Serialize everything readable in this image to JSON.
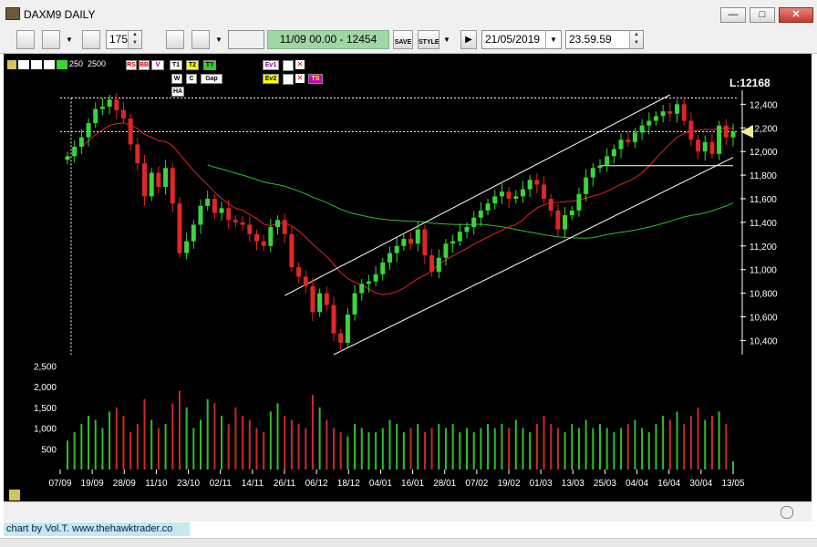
{
  "window": {
    "title": "DAXM9 DAILY",
    "minimize": "—",
    "maximize": "□",
    "close": "✕"
  },
  "toolbar": {
    "bars_value": "175",
    "info_text": "11/09 00.00 - 12454",
    "save_label": "SAVE",
    "style_label": "STYLE",
    "date_value": "21/05/2019",
    "time_value": "23.59.59",
    "play_label": "▶"
  },
  "legend": {
    "row1": [
      "250",
      "2500"
    ],
    "buttons": [
      "RS",
      "BB",
      "V",
      "T1",
      "T2",
      "T?",
      "Ev1",
      "Ev2",
      "TS",
      "Gap",
      "HA",
      "W",
      "C"
    ]
  },
  "price_label": "L:12168",
  "colors": {
    "up": "#39d639",
    "down": "#e02626",
    "ma_fast": "#e02626",
    "ma_slow": "#2fbf2f",
    "channel": "#ffffff",
    "volume_up": "#2fbf2f",
    "volume_down": "#c92a2a",
    "marker": "#f5ec8f"
  },
  "chart_data": {
    "type": "candlestick",
    "x_ticks": [
      "07/09",
      "19/09",
      "28/09",
      "11/10",
      "23/10",
      "02/11",
      "14/11",
      "26/11",
      "06/12",
      "18/12",
      "04/01",
      "16/01",
      "28/01",
      "07/02",
      "19/02",
      "01/03",
      "13/03",
      "25/03",
      "04/04",
      "16/04",
      "30/04",
      "13/05"
    ],
    "y_ticks": [
      10400,
      10600,
      10800,
      11000,
      11200,
      11400,
      11600,
      11800,
      12000,
      12200,
      12400
    ],
    "ylim": [
      10280,
      12480
    ],
    "volume_ticks": [
      500,
      1000,
      1500,
      2000,
      2500
    ],
    "volume_ylim": [
      0,
      2600
    ],
    "close": [
      11960,
      12040,
      12120,
      12240,
      12360,
      12380,
      12440,
      12350,
      12280,
      12060,
      11900,
      11620,
      11820,
      11700,
      11860,
      11560,
      11140,
      11240,
      11380,
      11540,
      11600,
      11480,
      11520,
      11420,
      11400,
      11380,
      11300,
      11240,
      11200,
      11360,
      11420,
      11300,
      11020,
      10940,
      10860,
      10640,
      10800,
      10700,
      10460,
      10380,
      10620,
      10800,
      10880,
      10900,
      10960,
      11060,
      11140,
      11200,
      11260,
      11220,
      11340,
      11120,
      10980,
      11100,
      11220,
      11240,
      11320,
      11360,
      11440,
      11500,
      11560,
      11620,
      11660,
      11600,
      11620,
      11680,
      11760,
      11720,
      11600,
      11500,
      11340,
      11460,
      11500,
      11640,
      11780,
      11860,
      11880,
      11960,
      12020,
      12100,
      12080,
      12160,
      12220,
      12260,
      12300,
      12340,
      12320,
      12400,
      12260,
      12100,
      12000,
      12080,
      11980,
      12220,
      12120,
      12168
    ],
    "volume": [
      700,
      900,
      1100,
      1300,
      1200,
      1000,
      1400,
      1500,
      1300,
      900,
      1100,
      1700,
      1200,
      1000,
      1100,
      1600,
      1900,
      1500,
      1000,
      1200,
      1700,
      1600,
      1300,
      1100,
      1500,
      1300,
      1200,
      1000,
      900,
      1400,
      1600,
      1300,
      1200,
      1100,
      1000,
      1800,
      1500,
      1200,
      1000,
      900,
      800,
      1100,
      1000,
      900,
      900,
      1000,
      1200,
      1100,
      900,
      1000,
      1100,
      900,
      1000,
      1100,
      1000,
      1100,
      900,
      1000,
      900,
      1000,
      1100,
      1000,
      1100,
      1000,
      1200,
      1000,
      900,
      1100,
      1300,
      1100,
      1000,
      900,
      1100,
      1000,
      1200,
      1000,
      1100,
      1000,
      900,
      1000,
      1100,
      1200,
      1000,
      900,
      1100,
      1300,
      1200,
      1400,
      1100,
      1300,
      1500,
      1200,
      1300,
      1400,
      1100,
      200
    ],
    "channel_label": "",
    "title": ""
  },
  "footer": {
    "credit": "chart by Vol.T. www.thehawktrader.co"
  }
}
